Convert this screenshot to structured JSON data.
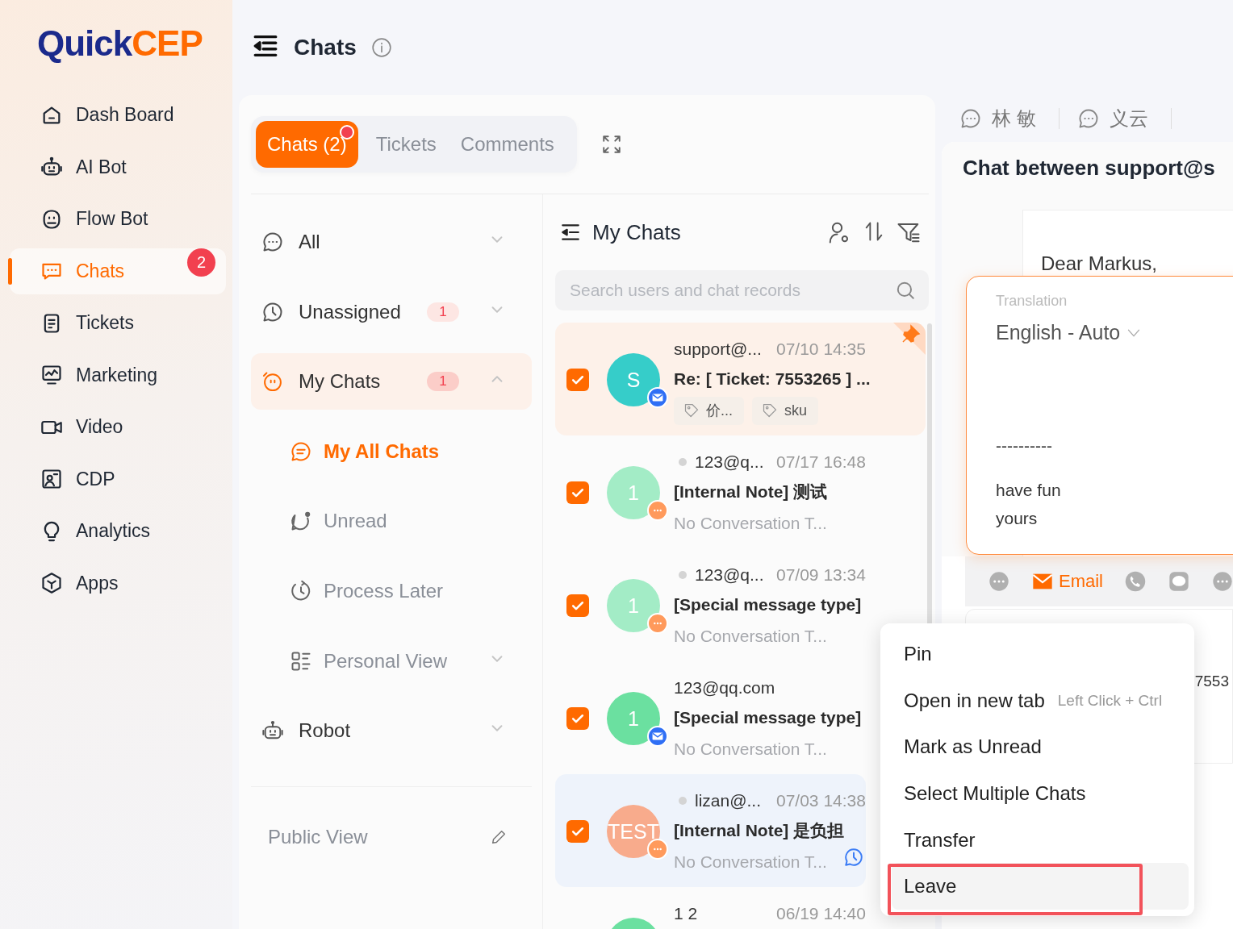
{
  "sidebar": {
    "logo": {
      "brand": "Quick",
      "suffix": "CEP"
    },
    "items": [
      {
        "label": "Dash Board",
        "selected": false
      },
      {
        "label": "AI Bot",
        "selected": false
      },
      {
        "label": "Flow Bot",
        "selected": false
      },
      {
        "label": "Chats",
        "selected": true,
        "badge": "2"
      },
      {
        "label": "Tickets",
        "selected": false
      },
      {
        "label": "Marketing",
        "selected": false
      },
      {
        "label": "Video",
        "selected": false
      },
      {
        "label": "CDP",
        "selected": false
      },
      {
        "label": "Analytics",
        "selected": false
      },
      {
        "label": "Apps",
        "selected": false
      }
    ]
  },
  "header": {
    "title": "Chats"
  },
  "tabs": [
    {
      "label": "Chats (2)",
      "selected": true,
      "dot": true
    },
    {
      "label": "Tickets",
      "selected": false,
      "dot": false
    },
    {
      "label": "Comments",
      "selected": false,
      "dot": false
    }
  ],
  "filters": {
    "items": [
      {
        "label": "All",
        "selected": false,
        "expanded": false
      },
      {
        "label": "Unassigned",
        "selected": false,
        "count": "1",
        "expanded": false
      },
      {
        "label": "My Chats",
        "selected": true,
        "count": "1",
        "expanded": true,
        "children": [
          {
            "label": "My All Chats",
            "selected": true
          },
          {
            "label": "Unread",
            "selected": false
          },
          {
            "label": "Process Later",
            "selected": false
          },
          {
            "label": "Personal View",
            "selected": false,
            "expanded": false
          }
        ]
      },
      {
        "label": "Robot",
        "selected": false,
        "expanded": false
      }
    ],
    "public_view": "Public View"
  },
  "chat_list": {
    "title": "My Chats",
    "search": {
      "placeholder": "Search users and chat records"
    },
    "rows": [
      {
        "checked": true,
        "avatar": "S",
        "color": "#36cdc9",
        "kind": "email",
        "status_dot": false,
        "name": "support@...",
        "time": "07/10 14:35",
        "subject": "Re: [ Ticket: 7553265 ] ...",
        "tags": [
          "价...",
          "sku"
        ],
        "pinned": true,
        "selected": true,
        "hovered": false,
        "process_later": false
      },
      {
        "checked": true,
        "avatar": "1",
        "color": "#a3ecc6",
        "kind": "chat",
        "status_dot": true,
        "name": "123@q...",
        "time": "07/17 16:48",
        "subject": "[Internal Note] 测试",
        "preview": "No Conversation T...",
        "pinned": false,
        "selected": false,
        "hovered": false,
        "process_later": false
      },
      {
        "checked": true,
        "avatar": "1",
        "color": "#a3ecc6",
        "kind": "chat",
        "status_dot": true,
        "name": "123@q...",
        "time": "07/09 13:34",
        "subject": "[Special message type]",
        "preview": "No Conversation T...",
        "pinned": false,
        "selected": false,
        "hovered": false,
        "process_later": false
      },
      {
        "checked": true,
        "avatar": "1",
        "color": "#6be0a0",
        "kind": "email",
        "status_dot": false,
        "name": "123@qq.com",
        "subject": "[Special message type]",
        "preview": "No Conversation T...",
        "pinned": false,
        "selected": false,
        "hovered": false,
        "process_later": false
      },
      {
        "checked": true,
        "avatar": "TEST",
        "color": "#f8ab8c",
        "kind": "chat",
        "status_dot": true,
        "name": "lizan@...",
        "time": "07/03 14:38",
        "subject": "[Internal Note] 是负担",
        "preview": "No Conversation T...",
        "pinned": false,
        "selected": false,
        "hovered": true,
        "process_later": true
      },
      {
        "color": "#6be0a0",
        "name": "1 2",
        "time": "06/19 14:40"
      }
    ]
  },
  "conversation": {
    "tabs": [
      {
        "label": "林 敏"
      },
      {
        "label": "义云"
      }
    ],
    "title": "Chat between support@s",
    "greeting": "Dear Markus,",
    "translation": {
      "label": "Translation",
      "language": "English - Auto",
      "lines": [
        "----------",
        "have fun",
        "yours"
      ]
    },
    "channels": [
      {
        "kind": "chat",
        "selected": false
      },
      {
        "kind": "email",
        "label": "Email",
        "selected": true
      },
      {
        "kind": "phone",
        "selected": false
      },
      {
        "kind": "line",
        "selected": false
      },
      {
        "kind": "chat",
        "selected": false
      }
    ],
    "ticket_fragment": "7553"
  },
  "context_menu": {
    "items": [
      {
        "label": "Pin",
        "highlighted": false
      },
      {
        "label": "Open in new tab",
        "shortcut": "Left Click + Ctrl",
        "highlighted": false
      },
      {
        "label": "Mark as Unread",
        "highlighted": false
      },
      {
        "label": "Select Multiple Chats",
        "highlighted": false
      },
      {
        "label": "Transfer",
        "highlighted": false
      },
      {
        "label": "Leave",
        "highlighted": true
      }
    ]
  }
}
